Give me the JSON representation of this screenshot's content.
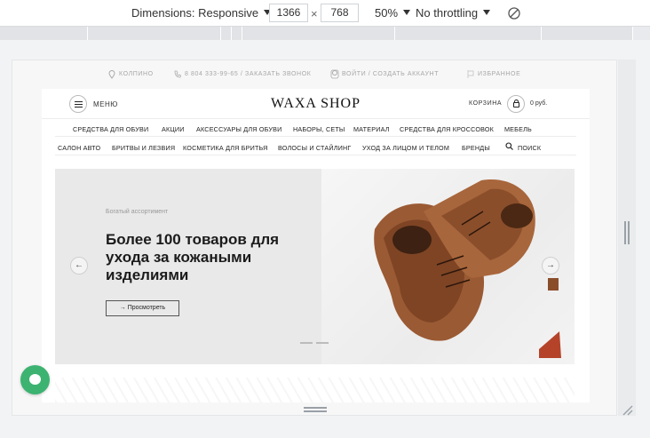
{
  "devtools": {
    "dimensions_label": "Dimensions: Responsive",
    "width": "1366",
    "times": "×",
    "height": "768",
    "zoom": "50%",
    "throttling": "No throttling",
    "rotate_icon": "rotate-icon"
  },
  "utility": {
    "location": "КОЛПИНО",
    "phone": "8 804 333-99-65 / ЗАКАЗАТЬ ЗВОНОК",
    "account": "ВОЙТИ / СОЗДАТЬ АККАУНТ",
    "favorites": "ИЗБРАННОЕ"
  },
  "header": {
    "menu_label": "МЕНЮ",
    "logo": "WAXA SHOP",
    "cart_label": "КОРЗИНА",
    "cart_sum": "0 руб."
  },
  "nav_row1": [
    "СРЕДСТВА ДЛЯ ОБУВИ",
    "АКЦИИ",
    "АКСЕССУАРЫ ДЛЯ ОБУВИ",
    "НАБОРЫ, СЕТЫ",
    "МАТЕРИАЛ",
    "СРЕДСТВА ДЛЯ КРОССОВОК",
    "МЕБЕЛЬ"
  ],
  "nav_row2": [
    "САЛОН АВТО",
    "БРИТВЫ И ЛЕЗВИЯ",
    "КОСМЕТИКА ДЛЯ БРИТЬЯ",
    "ВОЛОСЫ И СТАЙЛИНГ",
    "УХОД ЗА ЛИЦОМ И ТЕЛОМ",
    "БРЕНДЫ",
    "ПОИСК"
  ],
  "hero": {
    "eyebrow": "Богатый ассортимент",
    "headline": "Более 100 товаров для ухода за кожаными изделиями",
    "cta": "→ Просмотреть",
    "prev": "←",
    "next": "→"
  },
  "colors": {
    "accent_chat": "#3cb371",
    "boot": "#9a5a34"
  }
}
